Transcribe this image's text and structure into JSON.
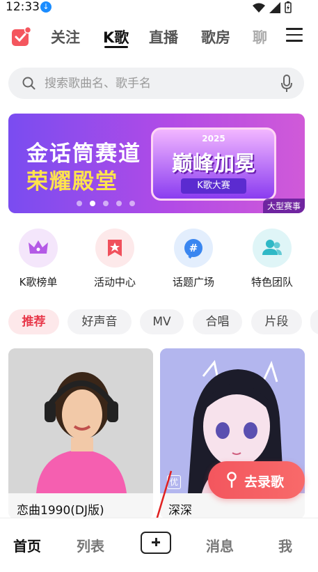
{
  "status_bar": {
    "time": "12:33"
  },
  "top_nav": {
    "tabs": [
      {
        "label": "关注"
      },
      {
        "label": "K歌"
      },
      {
        "label": "直播"
      },
      {
        "label": "歌房"
      },
      {
        "label": "聊"
      }
    ],
    "active_index": 1
  },
  "search": {
    "placeholder": "搜索歌曲名、歌手名"
  },
  "banner": {
    "title_line1": "金话筒赛道",
    "title_line2": "荣耀殿堂",
    "badge_year": "2025",
    "badge_main": "巅峰加冕",
    "badge_sub": "K歌大赛",
    "tag": "大型赛事",
    "dots": 5,
    "active_dot": 1
  },
  "quick_entries": [
    {
      "label": "K歌榜单",
      "icon": "crown-icon",
      "color": "#f4e6fb"
    },
    {
      "label": "活动中心",
      "icon": "star-flag-icon",
      "color": "#fde9ea"
    },
    {
      "label": "话题广场",
      "icon": "hashtag-icon",
      "color": "#e3eefd"
    },
    {
      "label": "特色团队",
      "icon": "group-icon",
      "color": "#dff5f7"
    }
  ],
  "categories": [
    "推荐",
    "好声音",
    "MV",
    "合唱",
    "片段"
  ],
  "active_category": 0,
  "cards": [
    {
      "title": "恋曲1990(DJ版)"
    },
    {
      "title": "深深",
      "badge": "优"
    }
  ],
  "record_button": {
    "label": "去录歌"
  },
  "bottom_nav": {
    "items": [
      "首页",
      "列表",
      "消息",
      "我"
    ],
    "active_index": 0
  },
  "colors": {
    "accent": "#f4565e",
    "banner": "#9b4cee"
  }
}
